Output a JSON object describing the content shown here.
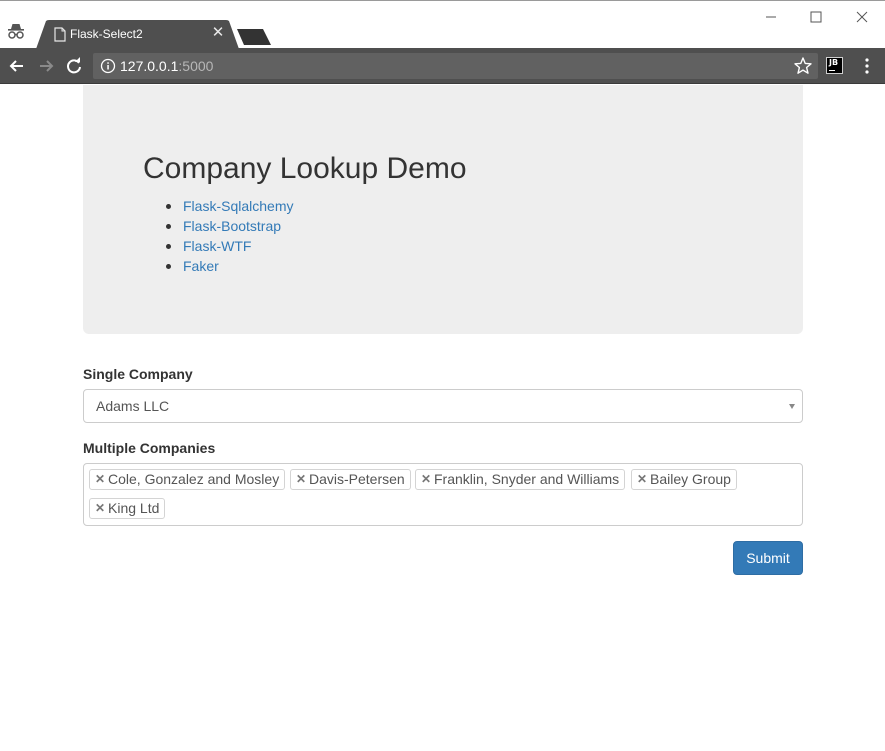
{
  "browser": {
    "tab_title": "Flask-Select2",
    "url_host": "127.0.0.1",
    "url_port": ":5000",
    "extension_label": "JB"
  },
  "page": {
    "title": "Company Lookup Demo",
    "links": [
      "Flask-Sqlalchemy",
      "Flask-Bootstrap",
      "Flask-WTF",
      "Faker"
    ]
  },
  "form": {
    "single_label": "Single Company",
    "single_value": "Adams LLC",
    "multi_label": "Multiple Companies",
    "multi_values": [
      "Cole, Gonzalez and Mosley",
      "Davis-Petersen",
      "Franklin, Snyder and Williams",
      "Bailey Group",
      "King Ltd"
    ],
    "submit_label": "Submit"
  },
  "colors": {
    "link": "#337ab7",
    "button": "#337ab7",
    "jumbotron": "#eeeeee",
    "toolbar": "#4f4f4f"
  },
  "icons": [
    "incognito-icon",
    "document-icon",
    "close-icon",
    "back-icon",
    "forward-icon",
    "reload-icon",
    "info-icon",
    "star-icon",
    "menu-icon"
  ]
}
